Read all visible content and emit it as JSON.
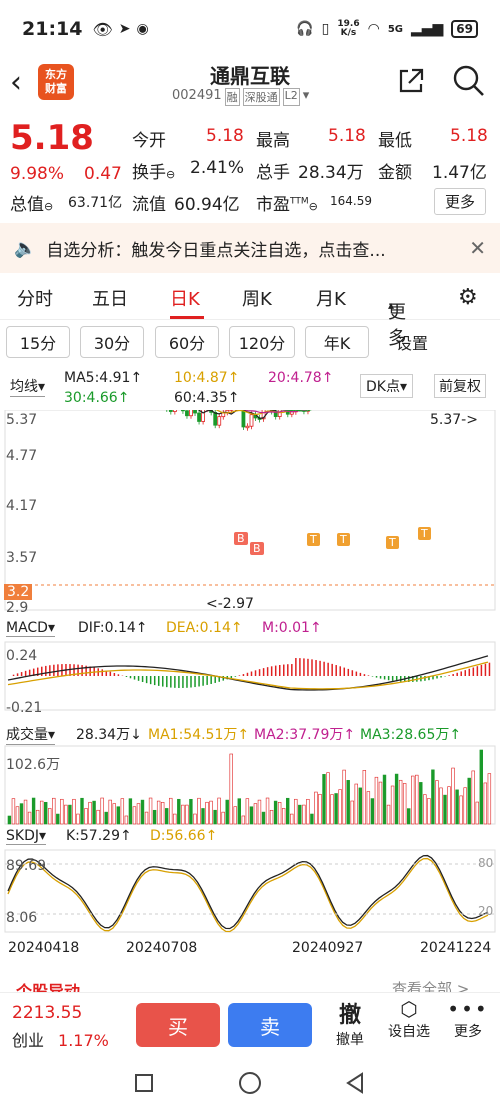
{
  "status": {
    "time": "21:14",
    "net_speed_top": "19.6",
    "net_speed_unit": "K/s",
    "battery": "69",
    "net_gen": "5G"
  },
  "header": {
    "logo_line1": "东方",
    "logo_line2": "财富",
    "title": "通鼎互联",
    "code": "002491",
    "tag_margin": "融",
    "tag_connect": "深股通",
    "tag_level": "L2"
  },
  "quote": {
    "price": "5.18",
    "change_pct": "9.98%",
    "change": "0.47",
    "open_label": "今开",
    "open": "5.18",
    "high_label": "最高",
    "high": "5.18",
    "low_label": "最低",
    "low": "5.18",
    "turnover_label": "换手",
    "turnover": "2.41%",
    "volume_label": "总手",
    "volume": "28.34万",
    "amount_label": "金额",
    "amount": "1.47亿",
    "mcap_label": "总值",
    "mcap": "63.71亿",
    "float_label": "流值",
    "float_cap": "60.94亿",
    "pe_label": "市盈",
    "pe_sup": "TTM",
    "pe": "164.59",
    "more": "更多"
  },
  "analysis": {
    "label": "自选分析：",
    "text": "触发今日重点关注自选，点击查..."
  },
  "tabs": [
    "分时",
    "五日",
    "日K",
    "周K",
    "月K",
    "更多"
  ],
  "period_tabs": [
    "15分",
    "30分",
    "60分",
    "120分",
    "年K",
    "设置"
  ],
  "ma_legend": {
    "ind": "均线",
    "ma5": "MA5:4.91",
    "ma10": "10:4.87",
    "ma20": "20:4.78",
    "ma30": "30:4.66",
    "ma60": "60:4.35",
    "dk": "DK点",
    "fq": "前复权"
  },
  "kline_labels": {
    "y1": "5.37",
    "y2": "4.77",
    "y3": "4.17",
    "y4": "3.57",
    "y5": "3.2",
    "y6": "2.9",
    "max_mark": "5.37->",
    "min_mark": "<-2.97",
    "b1": "B",
    "b2": "B",
    "t1": "T",
    "t2": "T",
    "t3": "T",
    "t4": "T"
  },
  "macd": {
    "name": "MACD",
    "dif": "DIF:0.14",
    "dea": "DEA:0.14",
    "m": "M:0.01",
    "y_top": "0.24",
    "y_bot": "-0.21"
  },
  "vol": {
    "name": "成交量",
    "val": "28.34万",
    "ma1": "MA1:54.51万",
    "ma2": "MA2:37.79万",
    "ma3": "MA3:28.65万",
    "y_top": "102.6万"
  },
  "skdj": {
    "name": "SKDJ",
    "k": "K:57.29",
    "d": "D:56.66",
    "y_top": "89.69",
    "y_bot": "8.06",
    "r80": "80",
    "r20": "20"
  },
  "dates": [
    "20240418",
    "20240708",
    "20240927",
    "20241224"
  ],
  "news": {
    "title": "个股异动",
    "link": "查看全部 >"
  },
  "bottom": {
    "index_val": "2213.55",
    "index_name": "创业",
    "index_pct": "1.17%",
    "buy": "买",
    "sell": "卖",
    "cancel": "撤单",
    "cancel_icon": "撤",
    "add": "设自选",
    "more": "更多"
  },
  "colors": {
    "up": "#e02020",
    "down": "#1a9a2a",
    "buy": "#e8534a",
    "sell": "#3d7cf0"
  }
}
